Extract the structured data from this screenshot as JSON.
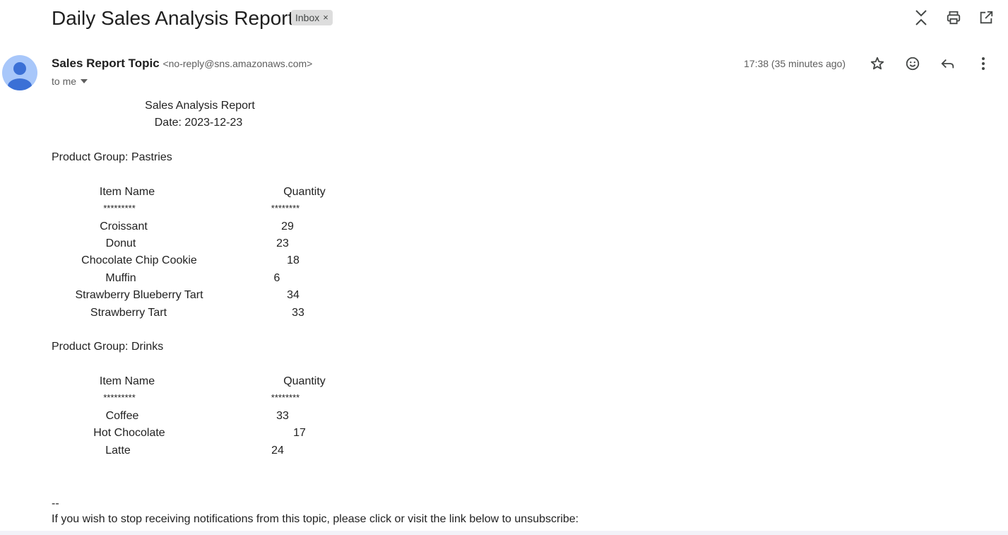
{
  "subject": "Daily Sales Analysis Report",
  "label": "Inbox",
  "label_close": "×",
  "top_icons": [
    "collapse-icon",
    "print-icon",
    "open-in-new-window-icon"
  ],
  "sender": {
    "name": "Sales Report Topic",
    "email": "<no-reply@sns.amazonaws.com>",
    "to": "to me",
    "time": "17:38 (35 minutes ago)"
  },
  "message_icons": [
    "star-icon",
    "emoji-icon",
    "reply-icon",
    "more-vert-icon"
  ],
  "report": {
    "title": "Sales Analysis Report",
    "date": "Date: 2023-12-23",
    "col_item": "Item Name",
    "col_qty": "Quantity",
    "sep_item": "*********",
    "sep_qty": "********",
    "groups": [
      {
        "heading": "Product Group: Pastries",
        "items": [
          {
            "name": "Croissant",
            "qty": "29"
          },
          {
            "name": "Donut",
            "qty": "23"
          },
          {
            "name": "Chocolate Chip Cookie",
            "qty": "18"
          },
          {
            "name": "Muffin",
            "qty": "6"
          },
          {
            "name": "Strawberry Blueberry Tart",
            "qty": "34"
          },
          {
            "name": "Strawberry Tart",
            "qty": "33"
          }
        ]
      },
      {
        "heading": "Product Group: Drinks",
        "items": [
          {
            "name": "Coffee",
            "qty": "33"
          },
          {
            "name": "Hot Chocolate",
            "qty": "17"
          },
          {
            "name": "Latte",
            "qty": "24"
          }
        ]
      }
    ]
  },
  "signature_sep": "--",
  "unsubscribe_text": "If you wish to stop receiving notifications from this topic, please click or visit the link below to unsubscribe:"
}
